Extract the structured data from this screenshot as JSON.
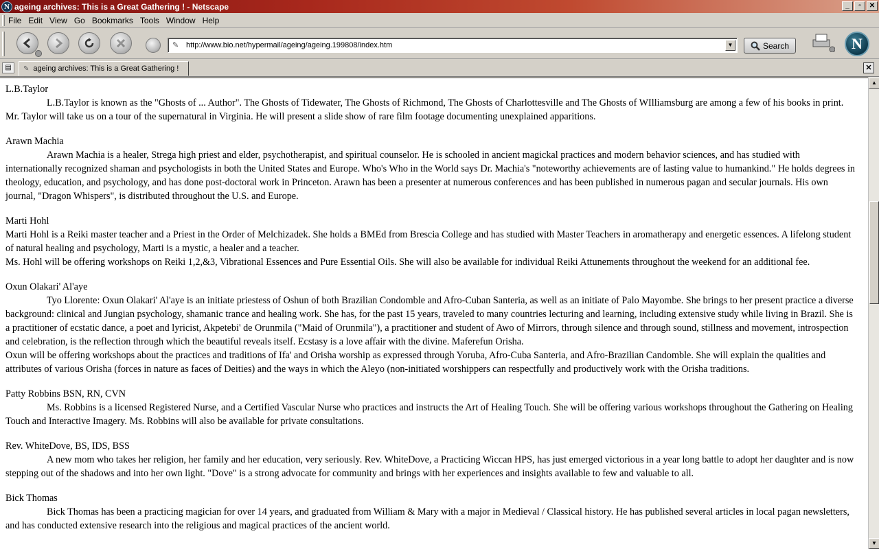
{
  "window": {
    "title": "ageing archives: This is a Great Gathering ! - Netscape",
    "app_icon_letter": "N",
    "controls": {
      "minimize": "_",
      "maximize": "▫",
      "close": "✕"
    }
  },
  "menu": {
    "items": [
      {
        "label": "File"
      },
      {
        "label": "Edit"
      },
      {
        "label": "View"
      },
      {
        "label": "Go"
      },
      {
        "label": "Bookmarks"
      },
      {
        "label": "Tools"
      },
      {
        "label": "Window"
      },
      {
        "label": "Help"
      }
    ]
  },
  "toolbar": {
    "url": "http://www.bio.net/hypermail/ageing/ageing.199808/index.htm",
    "search_label": "Search",
    "logo_letter": "N"
  },
  "tabs": [
    {
      "label": "ageing archives: This is a Great Gathering !"
    }
  ],
  "content": {
    "entries": [
      {
        "name": "L.B.Taylor",
        "paragraphs": [
          {
            "indent": true,
            "text": "L.B.Taylor is known as the \"Ghosts of ... Author\". The Ghosts of Tidewater, The Ghosts of Richmond, The Ghosts of Charlottesville and The Ghosts of WIlliamsburg are among a few of his books in print. Mr. Taylor will take us on a tour of the supernatural in Virginia. He will present a slide show of rare film footage documenting unexplained apparitions."
          }
        ]
      },
      {
        "name": "Arawn Machia",
        "paragraphs": [
          {
            "indent": true,
            "text": "Arawn Machia is a healer, Strega high priest and elder, psychotherapist, and spiritual counselor. He is schooled in ancient magickal practices and modern behavior sciences, and has studied with internationally recognized shaman and psychologists in both the United States and Europe. Who's Who in the World says Dr. Machia's \"noteworthy achievements are of lasting value to humankind.\" He holds degrees in theology, education, and psychology, and has done post-doctoral work in Princeton. Arawn has been a presenter at numerous conferences and has been published in numerous pagan and secular journals. His own journal, \"Dragon Whispers\", is distributed throughout the U.S. and Europe."
          }
        ]
      },
      {
        "name": "Marti Hohl",
        "paragraphs": [
          {
            "indent": false,
            "text": "Marti Hohl is a Reiki master teacher and a Priest in the Order of Melchizadek. She holds a BMEd from Brescia College and has studied with Master Teachers in aromatherapy and energetic essences. A lifelong student of natural healing and psychology, Marti is a mystic, a healer and a teacher."
          },
          {
            "indent": false,
            "text": "Ms. Hohl will be offering workshops on Reiki 1,2,&3, Vibrational Essences and Pure Essential Oils. She will also be available for individual Reiki Attunements throughout the weekend for an additional fee."
          }
        ]
      },
      {
        "name": "Oxun Olakari' Al'aye",
        "paragraphs": [
          {
            "indent": true,
            "text": "Tyo Llorente: Oxun Olakari' Al'aye is an initiate priestess of Oshun of both Brazilian Condomble and Afro-Cuban Santeria, as well as an initiate of Palo Mayombe. She brings to her present practice a diverse background: clinical and Jungian psychology, shamanic trance and healing work. She has, for the past 15 years, traveled to many countries lecturing and learning, including extensive study while living in Brazil. She is a practitioner of ecstatic dance, a poet and lyricist, Akpetebi' de Orunmila (\"Maid of Orunmila\"), a practitioner and student of Awo of Mirrors, through silence and through sound, stillness and movement, introspection and celebration, is the reflection through which the beautiful reveals itself. Ecstasy is a love affair with the divine. Maferefun Orisha."
          },
          {
            "indent": false,
            "text": "Oxun will be offering workshops about the practices and traditions of Ifa' and Orisha worship as expressed through Yoruba, Afro-Cuba Santeria, and Afro-Brazilian Candomble. She will explain the qualities and attributes of various Orisha (forces in nature as faces of Deities) and the ways in which the Aleyo (non-initiated worshippers can respectfully and productively work with the Orisha traditions."
          }
        ]
      },
      {
        "name": "Patty Robbins BSN, RN, CVN",
        "paragraphs": [
          {
            "indent": true,
            "text": "Ms. Robbins is a licensed Registered Nurse, and a Certified Vascular Nurse who practices and instructs the Art of Healing Touch. She will be offering various workshops throughout the Gathering on Healing Touch and Interactive Imagery. Ms. Robbins will also be available for private consultations."
          }
        ]
      },
      {
        "name": "Rev. WhiteDove, BS, IDS, BSS",
        "paragraphs": [
          {
            "indent": true,
            "text": "A new mom who takes her religion, her family and her education, very seriously. Rev. WhiteDove, a Practicing Wiccan HPS, has just emerged victorious in a year long battle to adopt her daughter and is now stepping out of the shadows and into her own light. \"Dove\" is a strong advocate for community and brings with her experiences and insights available to few and valuable to all."
          }
        ]
      },
      {
        "name": "Bick Thomas",
        "paragraphs": [
          {
            "indent": true,
            "text": "Bick Thomas has been a practicing magician for over 14 years, and graduated from William & Mary with a major in Medieval / Classical history. He has published several articles in local pagan newsletters, and has conducted extensive research into the religious and magical practices of the ancient world."
          }
        ]
      }
    ]
  }
}
